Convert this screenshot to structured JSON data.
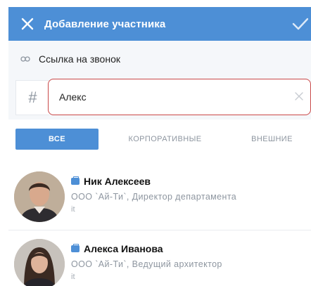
{
  "header": {
    "title": "Добавление участника",
    "close_icon": "close-icon",
    "confirm_icon": "check-icon",
    "background_color": "#4d8fd6"
  },
  "call_link": {
    "icon": "link-icon",
    "label": "Ссылка на звонок"
  },
  "search": {
    "prefix": "#",
    "value": "Алекс",
    "clear_icon": "clear-icon",
    "border_color": "#c94848"
  },
  "tabs": [
    {
      "label": "ВСЕ",
      "active": true
    },
    {
      "label": "КОРПОРАТИВНЫЕ",
      "active": false
    },
    {
      "label": "ВНЕШНИЕ",
      "active": false
    }
  ],
  "contacts": [
    {
      "name": "Ник Алексеев",
      "company_role": "ООО `Ай-Ти`, Директор департамента",
      "department": "it",
      "badge_icon": "briefcase-icon"
    },
    {
      "name": "Алекса Иванова",
      "company_role": "ООО `Ай-Ти`, Ведущий архитектор",
      "department": "it",
      "badge_icon": "briefcase-icon"
    }
  ]
}
